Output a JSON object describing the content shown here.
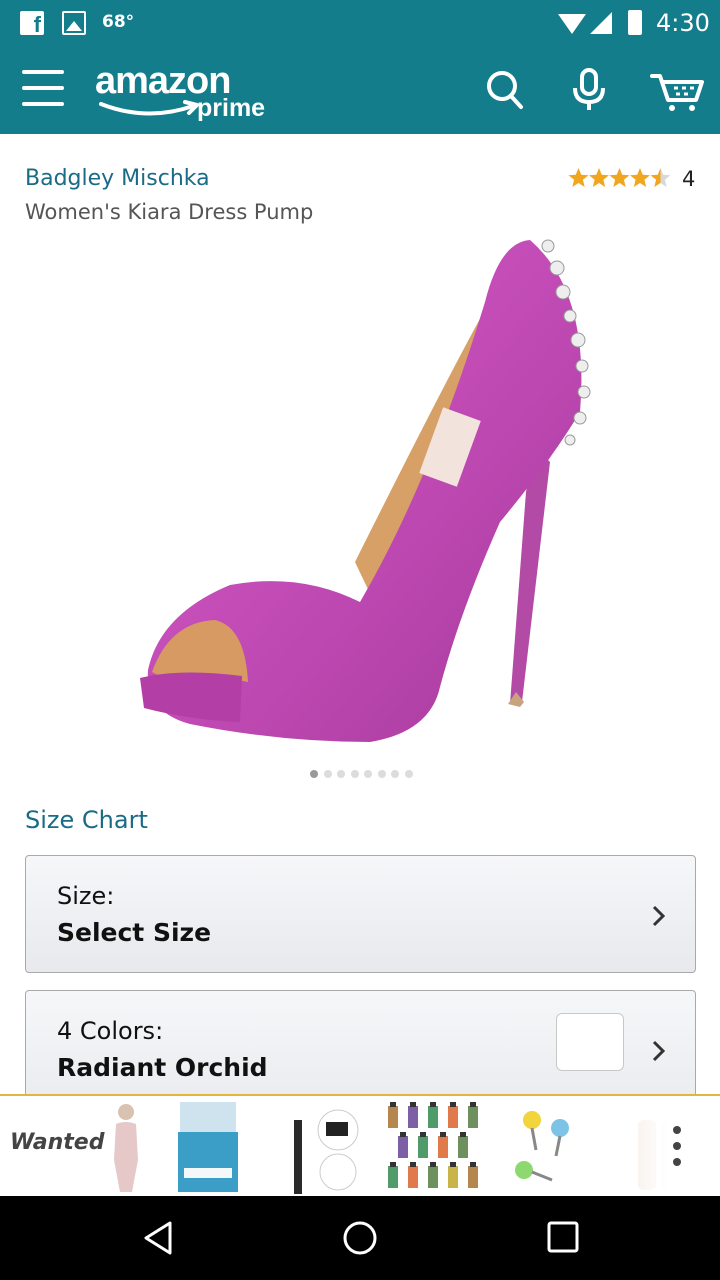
{
  "status_bar": {
    "temperature": "68°",
    "time": "4:30"
  },
  "header": {
    "logo_text": "amazon",
    "logo_sub": "prime"
  },
  "product": {
    "brand": "Badgley Mischka",
    "title": "Women's Kiara Dress Pump",
    "rating_count": "4",
    "rating_stars": 4.5,
    "image_count": 8,
    "active_image": 1,
    "color_hex": "#c84db8"
  },
  "links": {
    "size_chart": "Size Chart"
  },
  "size_selector": {
    "label": "Size:",
    "value": "Select Size"
  },
  "color_selector": {
    "label": "4 Colors:",
    "value": "Radiant Orchid"
  },
  "ad": {
    "title": "Wanted"
  },
  "colors": {
    "header_bg": "#137d8c",
    "link": "#1a6b86",
    "star": "#f0a61f"
  }
}
